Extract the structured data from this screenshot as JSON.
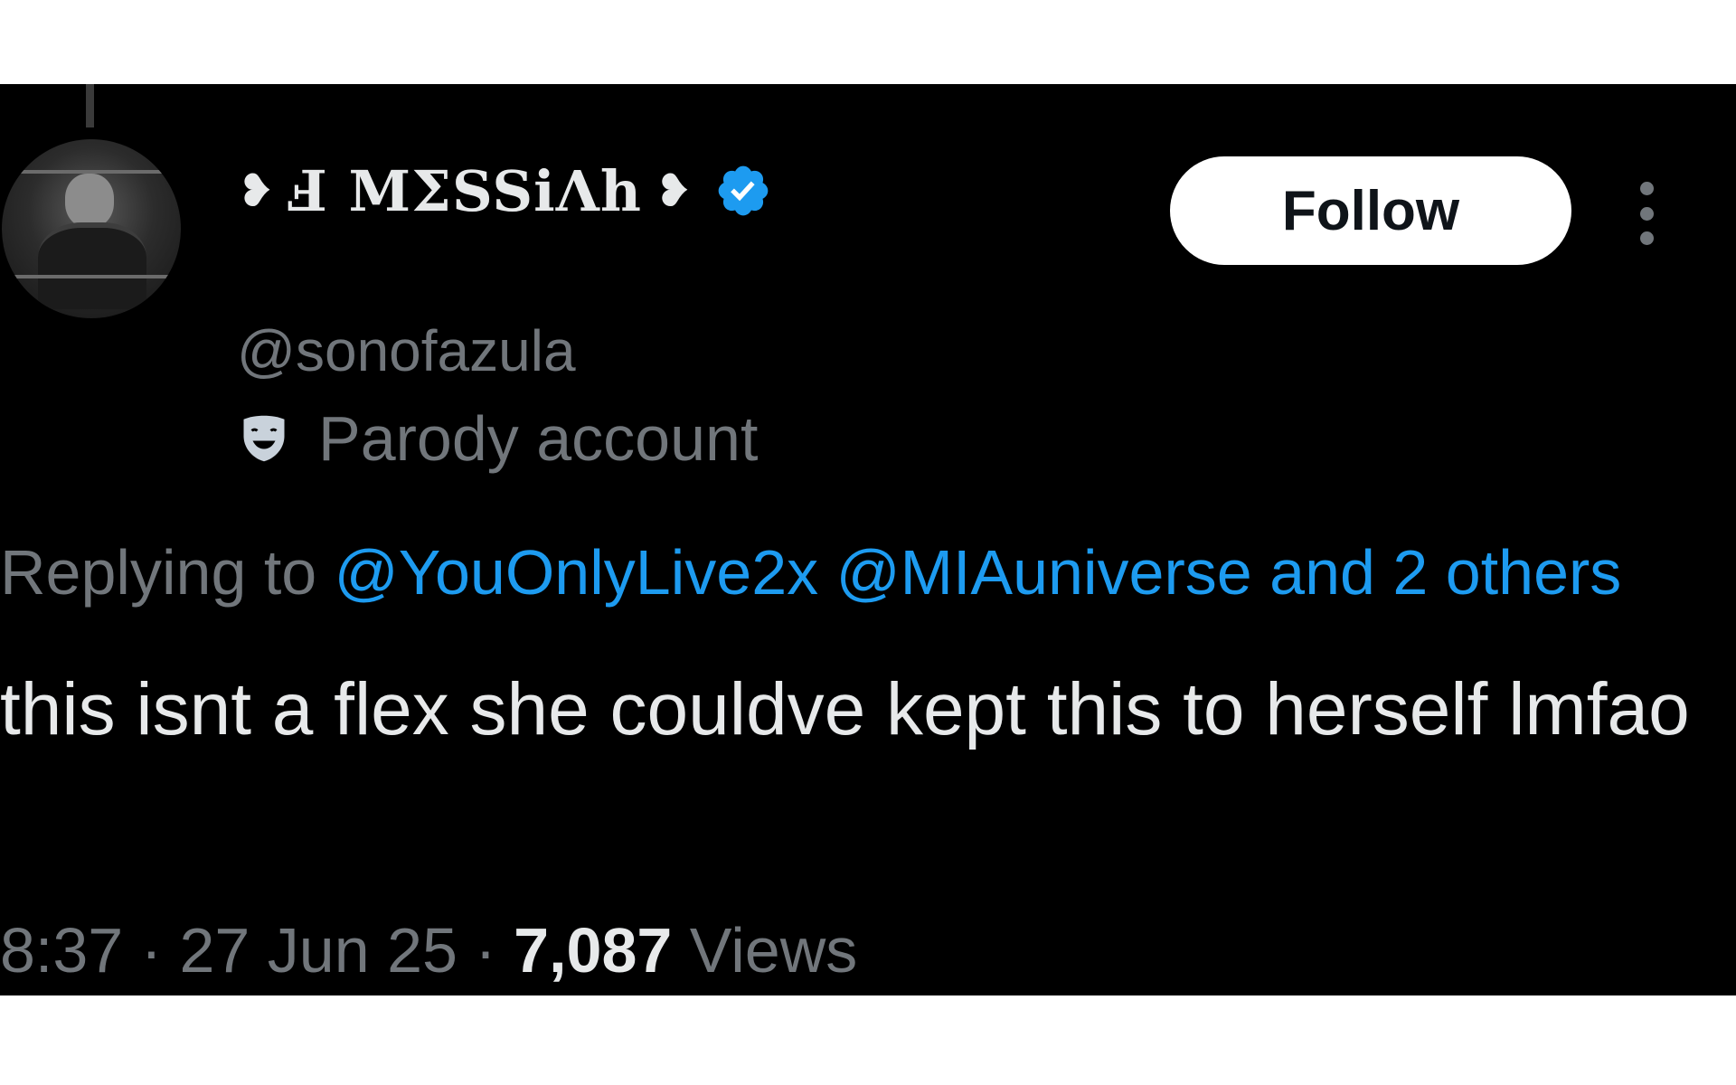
{
  "colors": {
    "background": "#000000",
    "primary_text": "#e7e9ea",
    "secondary_text": "#71767b",
    "accent_blue": "#1d9bf0",
    "follow_bg": "#ffffff",
    "follow_text": "#0f1419"
  },
  "author": {
    "avatar_icon": "profile-photo",
    "name_prefix_icon": "❥",
    "name_text": "Ⅎ MΣSSiɅh",
    "name_suffix_icon": "❥",
    "verified_icon": "verified-badge-icon",
    "handle": "@sonofazula",
    "label_icon": "theater-mask-icon",
    "label_text": "Parody account"
  },
  "actions": {
    "follow_label": "Follow",
    "more_icon": "more-vertical-icon"
  },
  "reply": {
    "prefix": "Replying to",
    "mention_1": "@YouOnlyLive2x",
    "mention_2": "@MIAuniverse",
    "others": "and 2 others"
  },
  "tweet": {
    "text": "this isnt a flex she couldve kept this to herself lmfao"
  },
  "meta": {
    "time": "8:37",
    "separator": "·",
    "date": "27 Jun 25",
    "views_count": "7,087",
    "views_label": "Views"
  }
}
